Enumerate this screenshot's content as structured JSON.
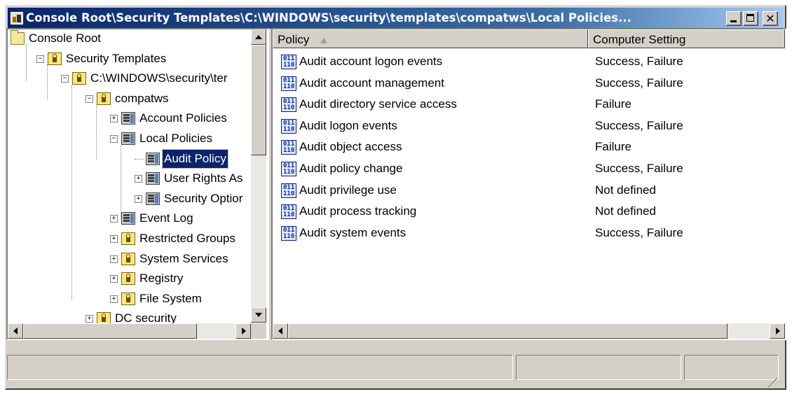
{
  "window": {
    "title": "Console Root\\Security Templates\\C:\\WINDOWS\\security\\templates\\compatws\\Local Policies...",
    "close_glyph": "✕"
  },
  "tree": {
    "items": [
      {
        "label": "Console Root",
        "icon": "folder-icon",
        "expander": ""
      },
      {
        "label": "Security Templates",
        "icon": "security-templates-icon",
        "expander": "−"
      },
      {
        "label": "C:\\WINDOWS\\security\\ter",
        "icon": "lock-folder-icon",
        "expander": "−"
      },
      {
        "label": "compatws",
        "icon": "lock-folder-icon",
        "expander": "−"
      },
      {
        "label": "Account Policies",
        "icon": "policy-icon",
        "expander": "+"
      },
      {
        "label": "Local Policies",
        "icon": "policy-icon",
        "expander": "−"
      },
      {
        "label": "Audit Policy",
        "icon": "policy-icon",
        "expander": "",
        "selected": true
      },
      {
        "label": "User Rights As",
        "icon": "policy-icon",
        "expander": "+"
      },
      {
        "label": "Security Optior",
        "icon": "policy-icon",
        "expander": "+"
      },
      {
        "label": "Event Log",
        "icon": "policy-icon",
        "expander": "+"
      },
      {
        "label": "Restricted Groups",
        "icon": "lock-folder-icon",
        "expander": "+"
      },
      {
        "label": "System Services",
        "icon": "lock-folder-icon",
        "expander": "+"
      },
      {
        "label": "Registry",
        "icon": "lock-folder-icon",
        "expander": "+"
      },
      {
        "label": "File System",
        "icon": "lock-folder-icon",
        "expander": "+"
      },
      {
        "label": "DC security",
        "icon": "lock-folder-icon",
        "expander": "+"
      }
    ]
  },
  "list": {
    "columns": [
      "Policy",
      "Computer Setting"
    ],
    "sort_column": "Policy",
    "rows": [
      {
        "policy": "Audit account logon events",
        "setting": "Success, Failure"
      },
      {
        "policy": "Audit account management",
        "setting": "Success, Failure"
      },
      {
        "policy": "Audit directory service access",
        "setting": "Failure"
      },
      {
        "policy": "Audit logon events",
        "setting": "Success, Failure"
      },
      {
        "policy": "Audit object access",
        "setting": "Failure"
      },
      {
        "policy": "Audit policy change",
        "setting": "Success, Failure"
      },
      {
        "policy": "Audit privilege use",
        "setting": "Not defined"
      },
      {
        "policy": "Audit process tracking",
        "setting": "Not defined"
      },
      {
        "policy": "Audit system events",
        "setting": "Success, Failure"
      }
    ],
    "row_icon_text_top": "011",
    "row_icon_text_bottom": "110"
  },
  "statusbar": {
    "panels": [
      "",
      "",
      ""
    ]
  },
  "colors": {
    "title_start": "#0a246a",
    "title_end": "#a6caf0",
    "selection": "#0a246a",
    "face": "#d4d0c8"
  }
}
